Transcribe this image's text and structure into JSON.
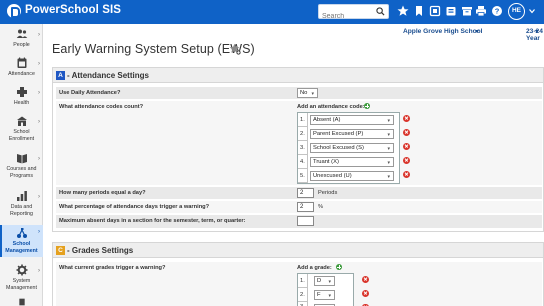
{
  "topbar": {
    "app_title": "PowerSchool SIS",
    "search_placeholder": "Search",
    "user_initials": "HE",
    "icons": [
      "search-icon",
      "star-icon",
      "bookmark-icon",
      "apps-icon",
      "archive-icon",
      "print-icon",
      "help-icon"
    ]
  },
  "sidebar": {
    "items": [
      {
        "label": "People",
        "icon": "people-icon"
      },
      {
        "label": "Attendance",
        "icon": "attendance-icon"
      },
      {
        "label": "Health",
        "icon": "health-icon"
      },
      {
        "label": "School Enrollment",
        "icon": "school-enrollment-icon"
      },
      {
        "label": "Courses and Programs",
        "icon": "courses-icon"
      },
      {
        "label": "Data and Reporting",
        "icon": "data-reporting-icon"
      },
      {
        "label": "School Management",
        "icon": "school-management-icon",
        "active": true
      },
      {
        "label": "System Management",
        "icon": "system-management-icon"
      }
    ]
  },
  "schoolbar": {
    "school": "Apple Grove High School",
    "term": "23-24 Year"
  },
  "page": {
    "title": "Early Warning System Setup (EWS)"
  },
  "attendance": {
    "letter": "A",
    "title": "- Attendance Settings",
    "use_daily_label": "Use Daily Attendance?",
    "use_daily_value": "No",
    "codes_label": "What attendance codes count?",
    "add_code_label": "Add an attendance code:",
    "codes": [
      {
        "num": "1.",
        "value": "Absent (A)"
      },
      {
        "num": "2.",
        "value": "Parent Excused (P)"
      },
      {
        "num": "3.",
        "value": "School Excused (S)"
      },
      {
        "num": "4.",
        "value": "Truant (X)"
      },
      {
        "num": "5.",
        "value": "Unexcused (U)"
      }
    ],
    "periods_label": "How many periods equal a day?",
    "periods_value": "2",
    "periods_unit": "Periods",
    "percent_label": "What percentage of attendance days trigger a warning?",
    "percent_value": "2",
    "percent_unit": "%",
    "max_absent_label": "Maximum absent days in a section for the semester, term, or quarter:",
    "max_absent_value": ""
  },
  "grades": {
    "letter": "C",
    "title": "- Grades Settings",
    "trigger_label": "What current grades trigger a warning?",
    "add_grade_label": "Add a grade:",
    "grades": [
      {
        "num": "1.",
        "value": "D"
      },
      {
        "num": "2.",
        "value": "F"
      },
      {
        "num": "3.",
        "value": "D-"
      }
    ]
  },
  "colors": {
    "brand": "#0f62c7",
    "section_a": "#1f57c3",
    "section_c": "#e5a11f",
    "delete": "#d9342b",
    "add": "#3c9a3c"
  }
}
